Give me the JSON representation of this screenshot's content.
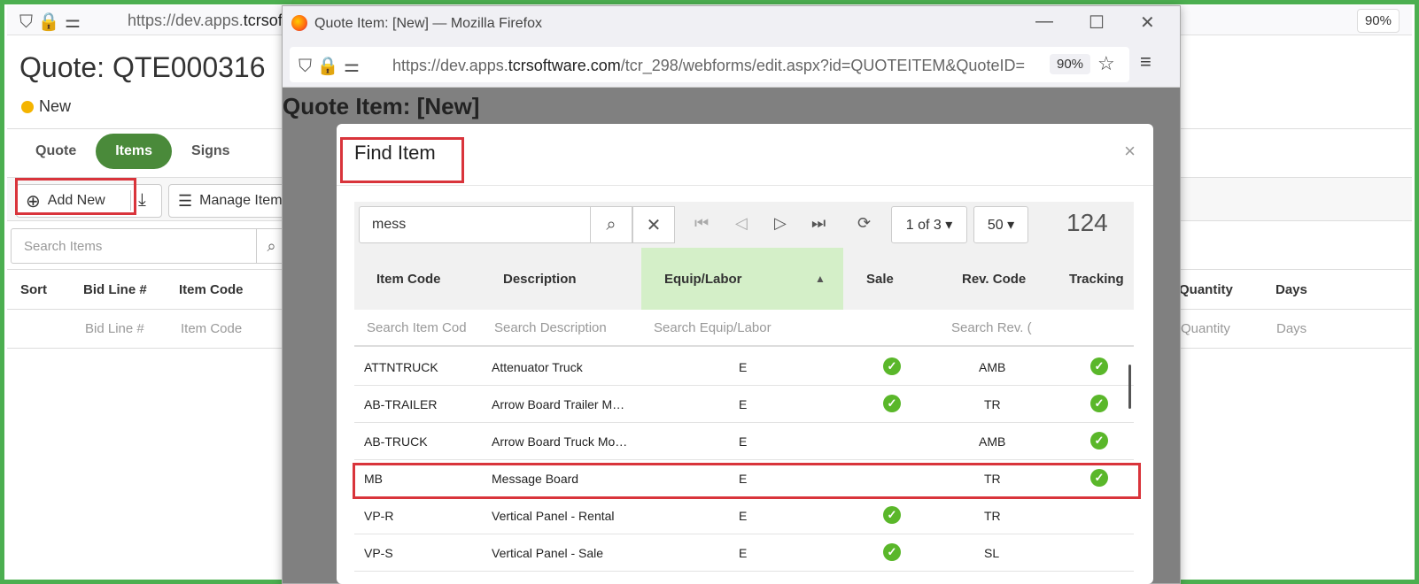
{
  "background": {
    "url_prefix": "https://dev.apps.",
    "url_host": "tcrsoft",
    "zoom": "90%",
    "page_title": "Quote: QTE000316",
    "status": "New",
    "tabs": [
      {
        "label": "Quote"
      },
      {
        "label": "Items"
      },
      {
        "label": "Signs"
      }
    ],
    "toolbar": {
      "add_new": "Add New",
      "manage_items": "Manage Item"
    },
    "search_placeholder": "Search Items",
    "columns": {
      "sort": "Sort",
      "bid_line": "Bid Line #",
      "item_code": "Item Code",
      "quantity": "Quantity",
      "days": "Days"
    },
    "filters": {
      "bid_line": "Bid Line #",
      "item_code": "Item Code",
      "quantity": "Quantity",
      "days": "Days"
    }
  },
  "firefox": {
    "window_title": "Quote Item: [New] — Mozilla Firefox",
    "url_prefix": "https://dev.apps.",
    "url_host": "tcrsoftware.com",
    "url_rest": "/tcr_298/webforms/edit.aspx?id=QUOTEITEM&QuoteID=",
    "zoom": "90%",
    "page_title": "Quote Item: [New]"
  },
  "modal": {
    "title": "Find Item",
    "close": "×",
    "search_value": "mess",
    "page_selector": "1 of 3 ▾",
    "page_size": "50 ▾",
    "total_count": "124",
    "columns": {
      "item_code": "Item Code",
      "description": "Description",
      "equip_labor": "Equip/Labor",
      "sale": "Sale",
      "rev_code": "Rev. Code",
      "tracking": "Tracking"
    },
    "filters": {
      "item_code": "Search Item Cod",
      "description": "Search Description",
      "equip_labor": "Search Equip/Labor",
      "rev_code": "Search Rev. ("
    },
    "rows": [
      {
        "code": "ATTNTRUCK",
        "desc": "Attenuator Truck",
        "type": "E",
        "sale": true,
        "rev": "AMB",
        "tracking": true
      },
      {
        "code": "AB-TRAILER",
        "desc": "Arrow Board Trailer M…",
        "type": "E",
        "sale": true,
        "rev": "TR",
        "tracking": true
      },
      {
        "code": "AB-TRUCK",
        "desc": "Arrow Board Truck Mo…",
        "type": "E",
        "sale": false,
        "rev": "AMB",
        "tracking": true
      },
      {
        "code": "MB",
        "desc": "Message Board",
        "type": "E",
        "sale": false,
        "rev": "TR",
        "tracking": true
      },
      {
        "code": "VP-R",
        "desc": "Vertical Panel - Rental",
        "type": "E",
        "sale": true,
        "rev": "TR",
        "tracking": false
      },
      {
        "code": "VP-S",
        "desc": "Vertical Panel - Sale",
        "type": "E",
        "sale": true,
        "rev": "SL",
        "tracking": false
      }
    ]
  }
}
